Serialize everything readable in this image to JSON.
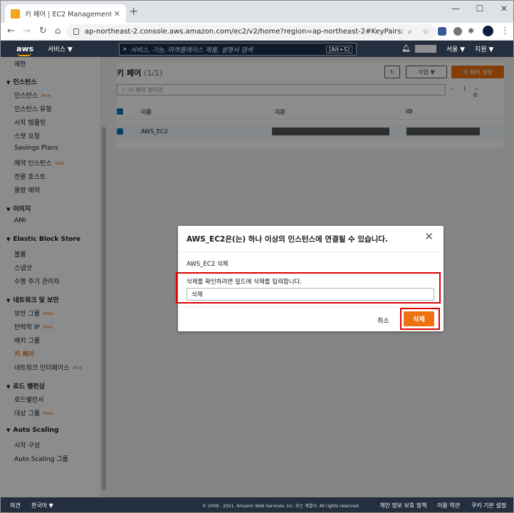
{
  "browser": {
    "tab_title": "키 페어 | EC2 Management Con",
    "url": "ap-northeast-2.console.aws.amazon.com/ec2/v2/home?region=ap-northeast-2#KeyPairs:"
  },
  "aws_nav": {
    "logo": "aws",
    "services": "서비스 ▼",
    "search_placeholder": "서비스, 기능, 마켓플레이스 제품, 설명서 검색",
    "search_shortcut": "[Alt+S]",
    "region": "서울 ▼",
    "support": "지원 ▼"
  },
  "sidebar": {
    "top_item": "제한",
    "sections": [
      {
        "title": "인스턴스",
        "items": [
          {
            "label": "인스턴스",
            "new": true
          },
          {
            "label": "인스턴스 유형",
            "new": false
          },
          {
            "label": "시작 템플릿",
            "new": false
          },
          {
            "label": "스팟 요청",
            "new": false
          },
          {
            "label": "Savings Plans",
            "new": false
          },
          {
            "label": "예약 인스턴스",
            "new": true
          },
          {
            "label": "전용 호스트",
            "new": false
          },
          {
            "label": "용량 예약",
            "new": false
          }
        ]
      },
      {
        "title": "이미지",
        "items": [
          {
            "label": "AMI",
            "new": false
          }
        ]
      },
      {
        "title": "Elastic Block Store",
        "items": [
          {
            "label": "볼륨",
            "new": false
          },
          {
            "label": "스냅샷",
            "new": false
          },
          {
            "label": "수명 주기 관리자",
            "new": false
          }
        ]
      },
      {
        "title": "네트워크 및 보안",
        "items": [
          {
            "label": "보안 그룹",
            "new": true
          },
          {
            "label": "탄력적 IP",
            "new": true
          },
          {
            "label": "배치 그룹",
            "new": false
          },
          {
            "label": "키 페어",
            "new": false,
            "active": true
          },
          {
            "label": "네트워크 인터페이스",
            "new": true
          }
        ]
      },
      {
        "title": "로드 밸런싱",
        "items": [
          {
            "label": "로드밸런서",
            "new": false
          },
          {
            "label": "대상 그룹",
            "new": true
          }
        ]
      },
      {
        "title": "Auto Scaling",
        "items": [
          {
            "label": "시작 구성",
            "new": false
          },
          {
            "label": "Auto Scaling 그룹",
            "new": false
          }
        ]
      }
    ],
    "new_badge": "New"
  },
  "main": {
    "title": "키 페어",
    "count": "(1/1)",
    "actions_label": "작업 ▼",
    "create_label": "키 페어 생성",
    "filter_placeholder": "키 페어 필터링",
    "page": "1",
    "columns": [
      "이름",
      "지문",
      "ID"
    ],
    "rows": [
      {
        "name": "AWS_EC2"
      }
    ]
  },
  "modal": {
    "title": "AWS_EC2은(는) 하나 이상의 인스턴스에 연결될 수 있습니다.",
    "delete_line": "AWS_EC2 삭제",
    "confirm_label": "삭제를 확인하려면 필드에 삭제를 입력합니다.",
    "input_value": "삭제",
    "cancel": "취소",
    "delete": "삭제"
  },
  "footer": {
    "feedback": "의견",
    "language": "한국어 ▼",
    "copyright": "© 2008 - 2021, Amazon Web Services, Inc. 또는 계열사. All rights reserved.",
    "privacy": "개인 정보 보호 정책",
    "terms": "이용 약관",
    "cookies": "쿠키 기본 설정"
  },
  "colors": {
    "accent": "#ec7211",
    "nav_bg": "#232f3e",
    "highlight": "#e00000"
  }
}
